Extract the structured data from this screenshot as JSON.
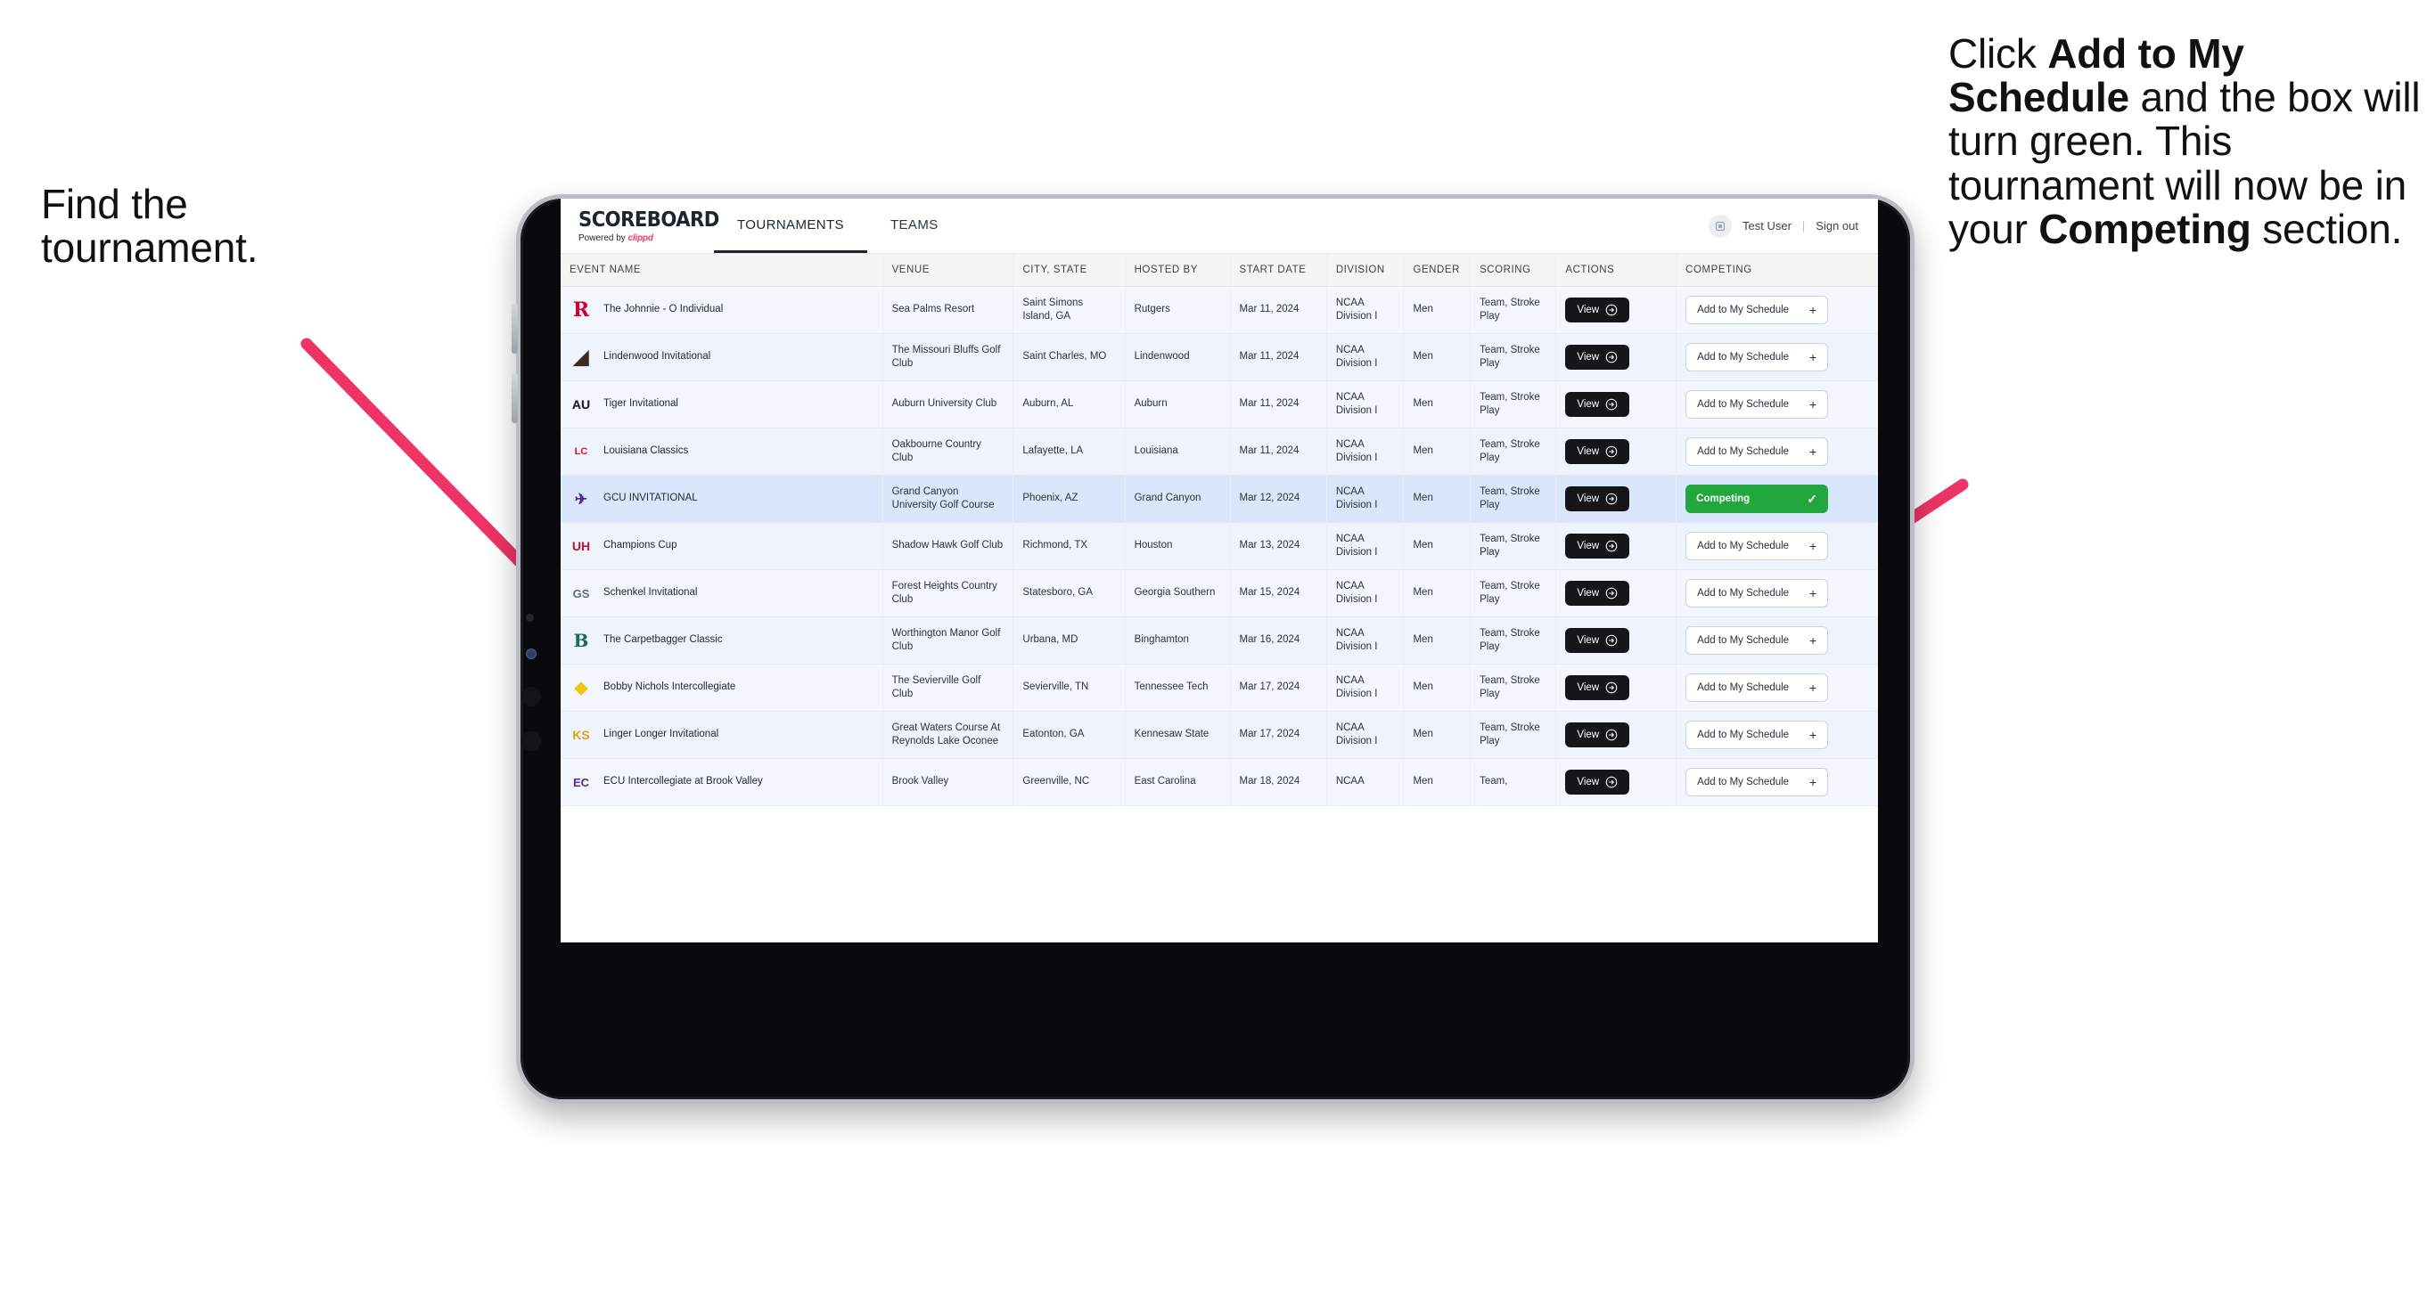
{
  "annotations": {
    "left": "Find the tournament.",
    "right_parts": [
      {
        "text": "Click ",
        "bold": false
      },
      {
        "text": "Add to My Schedule",
        "bold": true
      },
      {
        "text": " and the box will turn green. This tournament will now be in your ",
        "bold": false
      },
      {
        "text": "Competing",
        "bold": true
      },
      {
        "text": " section.",
        "bold": false
      }
    ],
    "arrow_color": "#ee3366"
  },
  "app": {
    "brand": {
      "title": "SCOREBOARD",
      "powered_prefix": "Powered by ",
      "powered_brand": "clippd"
    },
    "tabs": [
      {
        "label": "TOURNAMENTS",
        "active": true
      },
      {
        "label": "TEAMS",
        "active": false
      }
    ],
    "account": {
      "user": "Test User",
      "separator": "|",
      "sign_out": "Sign out",
      "avatar_icon": "user-badge-icon"
    },
    "table": {
      "columns": [
        "EVENT NAME",
        "VENUE",
        "CITY, STATE",
        "HOSTED BY",
        "START DATE",
        "DIVISION",
        "GENDER",
        "SCORING",
        "ACTIONS",
        "COMPETING"
      ],
      "view_label": "View",
      "add_label": "Add to My Schedule",
      "competing_label": "Competing",
      "rows": [
        {
          "logo": "rutgers-logo",
          "event": "The Johnnie - O Individual",
          "venue": "Sea Palms Resort",
          "city": "Saint Simons Island, GA",
          "hosted_by": "Rutgers",
          "start_date": "Mar 11, 2024",
          "division": "NCAA Division I",
          "gender": "Men",
          "scoring": "Team, Stroke Play",
          "competing": false,
          "selected": false
        },
        {
          "logo": "lindenwood-logo",
          "event": "Lindenwood Invitational",
          "venue": "The Missouri Bluffs Golf Club",
          "city": "Saint Charles, MO",
          "hosted_by": "Lindenwood",
          "start_date": "Mar 11, 2024",
          "division": "NCAA Division I",
          "gender": "Men",
          "scoring": "Team, Stroke Play",
          "competing": false,
          "selected": false
        },
        {
          "logo": "auburn-logo",
          "event": "Tiger Invitational",
          "venue": "Auburn University Club",
          "city": "Auburn, AL",
          "hosted_by": "Auburn",
          "start_date": "Mar 11, 2024",
          "division": "NCAA Division I",
          "gender": "Men",
          "scoring": "Team, Stroke Play",
          "competing": false,
          "selected": false
        },
        {
          "logo": "louisiana-logo",
          "event": "Louisiana Classics",
          "venue": "Oakbourne Country Club",
          "city": "Lafayette, LA",
          "hosted_by": "Louisiana",
          "start_date": "Mar 11, 2024",
          "division": "NCAA Division I",
          "gender": "Men",
          "scoring": "Team, Stroke Play",
          "competing": false,
          "selected": false
        },
        {
          "logo": "gcu-logo",
          "event": "GCU INVITATIONAL",
          "venue": "Grand Canyon University Golf Course",
          "city": "Phoenix, AZ",
          "hosted_by": "Grand Canyon",
          "start_date": "Mar 12, 2024",
          "division": "NCAA Division I",
          "gender": "Men",
          "scoring": "Team, Stroke Play",
          "competing": true,
          "selected": true
        },
        {
          "logo": "houston-logo",
          "event": "Champions Cup",
          "venue": "Shadow Hawk Golf Club",
          "city": "Richmond, TX",
          "hosted_by": "Houston",
          "start_date": "Mar 13, 2024",
          "division": "NCAA Division I",
          "gender": "Men",
          "scoring": "Team, Stroke Play",
          "competing": false,
          "selected": false
        },
        {
          "logo": "georgia-southern-logo",
          "event": "Schenkel Invitational",
          "venue": "Forest Heights Country Club",
          "city": "Statesboro, GA",
          "hosted_by": "Georgia Southern",
          "start_date": "Mar 15, 2024",
          "division": "NCAA Division I",
          "gender": "Men",
          "scoring": "Team, Stroke Play",
          "competing": false,
          "selected": false
        },
        {
          "logo": "binghamton-logo",
          "event": "The Carpetbagger Classic",
          "venue": "Worthington Manor Golf Club",
          "city": "Urbana, MD",
          "hosted_by": "Binghamton",
          "start_date": "Mar 16, 2024",
          "division": "NCAA Division I",
          "gender": "Men",
          "scoring": "Team, Stroke Play",
          "competing": false,
          "selected": false
        },
        {
          "logo": "tennessee-tech-logo",
          "event": "Bobby Nichols Intercollegiate",
          "venue": "The Sevierville Golf Club",
          "city": "Sevierville, TN",
          "hosted_by": "Tennessee Tech",
          "start_date": "Mar 17, 2024",
          "division": "NCAA Division I",
          "gender": "Men",
          "scoring": "Team, Stroke Play",
          "competing": false,
          "selected": false
        },
        {
          "logo": "kennesaw-state-logo",
          "event": "Linger Longer Invitational",
          "venue": "Great Waters Course At Reynolds Lake Oconee",
          "city": "Eatonton, GA",
          "hosted_by": "Kennesaw State",
          "start_date": "Mar 17, 2024",
          "division": "NCAA Division I",
          "gender": "Men",
          "scoring": "Team, Stroke Play",
          "competing": false,
          "selected": false
        },
        {
          "logo": "east-carolina-logo",
          "event": "ECU Intercollegiate at Brook Valley",
          "venue": "Brook Valley",
          "city": "Greenville, NC",
          "hosted_by": "East Carolina",
          "start_date": "Mar 18, 2024",
          "division": "NCAA",
          "gender": "Men",
          "scoring": "Team,",
          "competing": false,
          "selected": false
        }
      ]
    }
  }
}
